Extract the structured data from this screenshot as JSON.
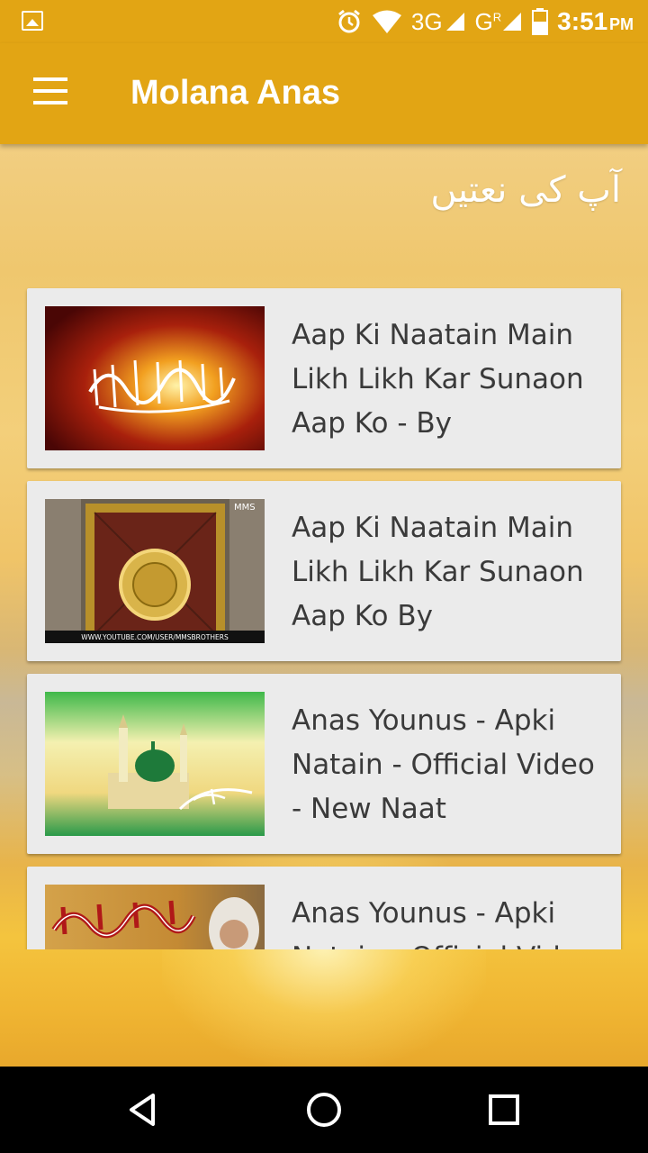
{
  "status_bar": {
    "time": "3:51",
    "ampm": "PM",
    "network_1": "3G",
    "network_2": "G",
    "network_2_super": "R",
    "icons": [
      "image-icon",
      "alarm-icon",
      "wifi-icon",
      "signal-icon",
      "battery-icon"
    ]
  },
  "app_bar": {
    "title": "Molana Anas",
    "menu_icon": "hamburger-menu-icon"
  },
  "heading": {
    "urdu": "آپ کی نعتیں"
  },
  "videos": [
    {
      "title": "Aap Ki Naatain Main Likh Likh Kar Sunaon Aap Ko - By",
      "thumbnail": "red-calligraphy-thumbnail"
    },
    {
      "title": "Aap Ki Naatain Main Likh Likh Kar Sunaon Aap Ko By",
      "thumbnail": "golden-door-thumbnail",
      "thumb_text": "WWW.YOUTUBE.COM/USER/MMSBROTHERS",
      "thumb_badge": "MMS"
    },
    {
      "title": "Anas Younus - Apki Natain - Official Video - New Naat",
      "thumbnail": "green-dome-thumbnail"
    },
    {
      "title": "Anas Younus - Apki Natain - Official Video - New Naat",
      "thumbnail": "urdu-text-portrait-thumbnail"
    }
  ],
  "nav_bar": {
    "buttons": [
      "back-icon",
      "home-icon",
      "recents-icon"
    ]
  },
  "colors": {
    "primary": "#e2a514",
    "card": "#ebebeb",
    "card_text": "#3a3a3a"
  }
}
